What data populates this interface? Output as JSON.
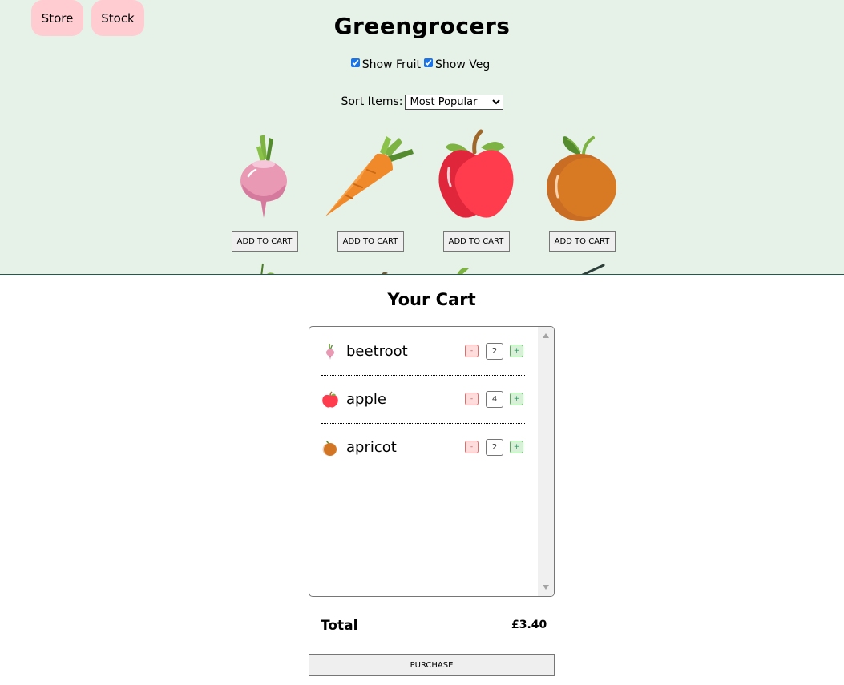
{
  "nav": {
    "store_label": "Store",
    "stock_label": "Stock"
  },
  "header": {
    "title": "Greengrocers"
  },
  "filters": {
    "fruit_label": "Show Fruit",
    "veg_label": "Show Veg",
    "fruit_checked": true,
    "veg_checked": true
  },
  "sort": {
    "label": "Sort Items:",
    "selected": "Most Popular"
  },
  "products": [
    {
      "name": "beetroot",
      "icon": "beetroot-icon",
      "button": "ADD TO CART"
    },
    {
      "name": "carrot",
      "icon": "carrot-icon",
      "button": "ADD TO CART"
    },
    {
      "name": "apple",
      "icon": "apple-icon",
      "button": "ADD TO CART"
    },
    {
      "name": "apricot",
      "icon": "apricot-icon",
      "button": "ADD TO CART"
    }
  ],
  "cart": {
    "title": "Your Cart",
    "items": [
      {
        "name": "beetroot",
        "icon": "beetroot-icon",
        "quantity": "2",
        "minus": "-",
        "plus": "+"
      },
      {
        "name": "apple",
        "icon": "apple-icon",
        "quantity": "4",
        "minus": "-",
        "plus": "+"
      },
      {
        "name": "apricot",
        "icon": "apricot-icon",
        "quantity": "2",
        "minus": "-",
        "plus": "+"
      }
    ],
    "total_label": "Total",
    "total_value": "£3.40",
    "purchase_label": "PURCHASE"
  },
  "colors": {
    "store_bg": "#e6f2e8",
    "nav_button": "#ffccd1",
    "minus_button": "#ffdddd",
    "plus_button": "#d7f0d7"
  }
}
